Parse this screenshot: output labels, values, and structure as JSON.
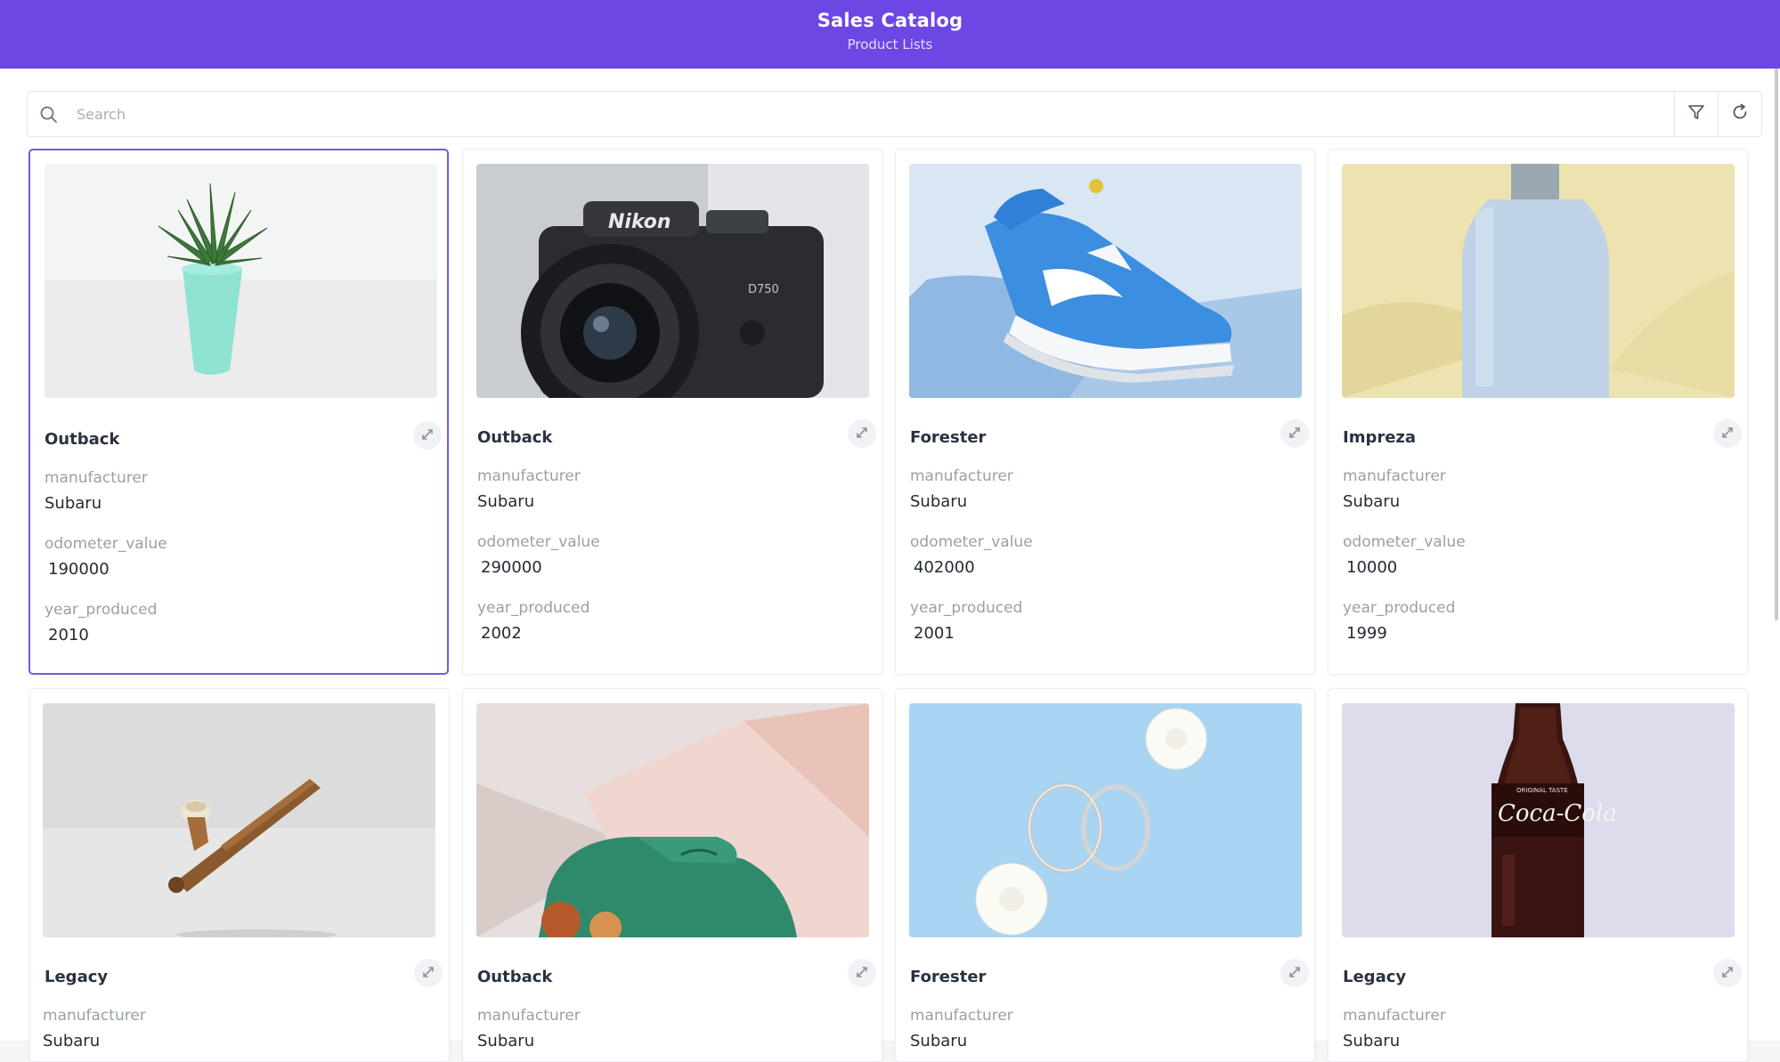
{
  "header": {
    "title": "Sales Catalog",
    "subtitle": "Product Lists"
  },
  "search": {
    "placeholder": "Search",
    "value": ""
  },
  "toolbar": {
    "filter_icon": "filter-icon",
    "refresh_icon": "refresh-icon"
  },
  "labels": {
    "manufacturer": "manufacturer",
    "odometer_value": "odometer_value",
    "year_produced": "year_produced"
  },
  "colors": {
    "header": "#6c47e4",
    "selected_border": "#7a57e0"
  },
  "cards": [
    {
      "model": "Outback",
      "manufacturer": "Subaru",
      "odometer_value": "190000",
      "year_produced": "2010",
      "image": "succulent-plant",
      "selected": true
    },
    {
      "model": "Outback",
      "manufacturer": "Subaru",
      "odometer_value": "290000",
      "year_produced": "2002",
      "image": "nikon-camera",
      "selected": false
    },
    {
      "model": "Forester",
      "manufacturer": "Subaru",
      "odometer_value": "402000",
      "year_produced": "2001",
      "image": "blue-sneaker",
      "selected": false
    },
    {
      "model": "Impreza",
      "manufacturer": "Subaru",
      "odometer_value": "10000",
      "year_produced": "1999",
      "image": "perfume-bottle",
      "selected": false
    },
    {
      "model": "Legacy",
      "manufacturer": "Subaru",
      "image": "wooden-pipe",
      "selected": false
    },
    {
      "model": "Outback",
      "manufacturer": "Subaru",
      "image": "green-shoe",
      "selected": false
    },
    {
      "model": "Forester",
      "manufacturer": "Subaru",
      "image": "hoop-earrings",
      "selected": false
    },
    {
      "model": "Legacy",
      "manufacturer": "Subaru",
      "image": "coca-cola-bottle",
      "selected": false
    }
  ]
}
